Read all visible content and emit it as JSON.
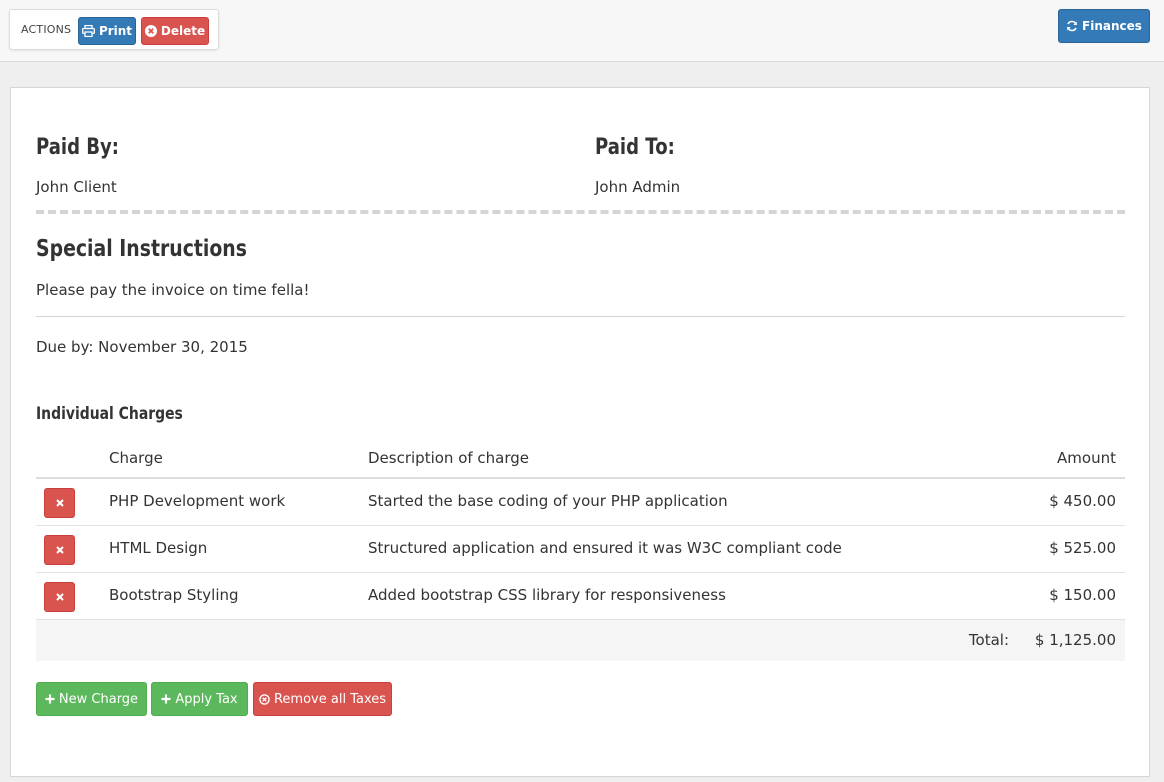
{
  "toolbar": {
    "actions_label": "ACTIONS",
    "print_label": "Print",
    "delete_label": "Delete",
    "finances_label": "Finances"
  },
  "invoice": {
    "paid_by_heading": "Paid By:",
    "paid_by_value": "John Client",
    "paid_to_heading": "Paid To:",
    "paid_to_value": "John Admin",
    "special_heading": "Special Instructions",
    "special_text": "Please pay the invoice on time fella!",
    "due": "Due by: November 30, 2015"
  },
  "charges": {
    "heading": "Individual Charges",
    "columns": [
      "Charge",
      "Description of charge",
      "Amount"
    ],
    "rows": [
      {
        "charge": "PHP Development work",
        "description": "Started the base coding of your PHP application",
        "amount": "$ 450.00"
      },
      {
        "charge": "HTML Design",
        "description": "Structured application and ensured it was W3C compliant code",
        "amount": "$ 525.00"
      },
      {
        "charge": "Bootstrap Styling",
        "description": "Added bootstrap CSS library for responsiveness",
        "amount": "$ 150.00"
      }
    ],
    "total_label": "Total:",
    "total_value": "$ 1,125.00"
  },
  "footer_buttons": {
    "new_charge": "New Charge",
    "apply_tax": "Apply Tax",
    "remove_taxes": "Remove all Taxes"
  },
  "colors": {
    "primary": "#337ab7",
    "danger": "#d9534f",
    "success": "#5cb85c"
  }
}
